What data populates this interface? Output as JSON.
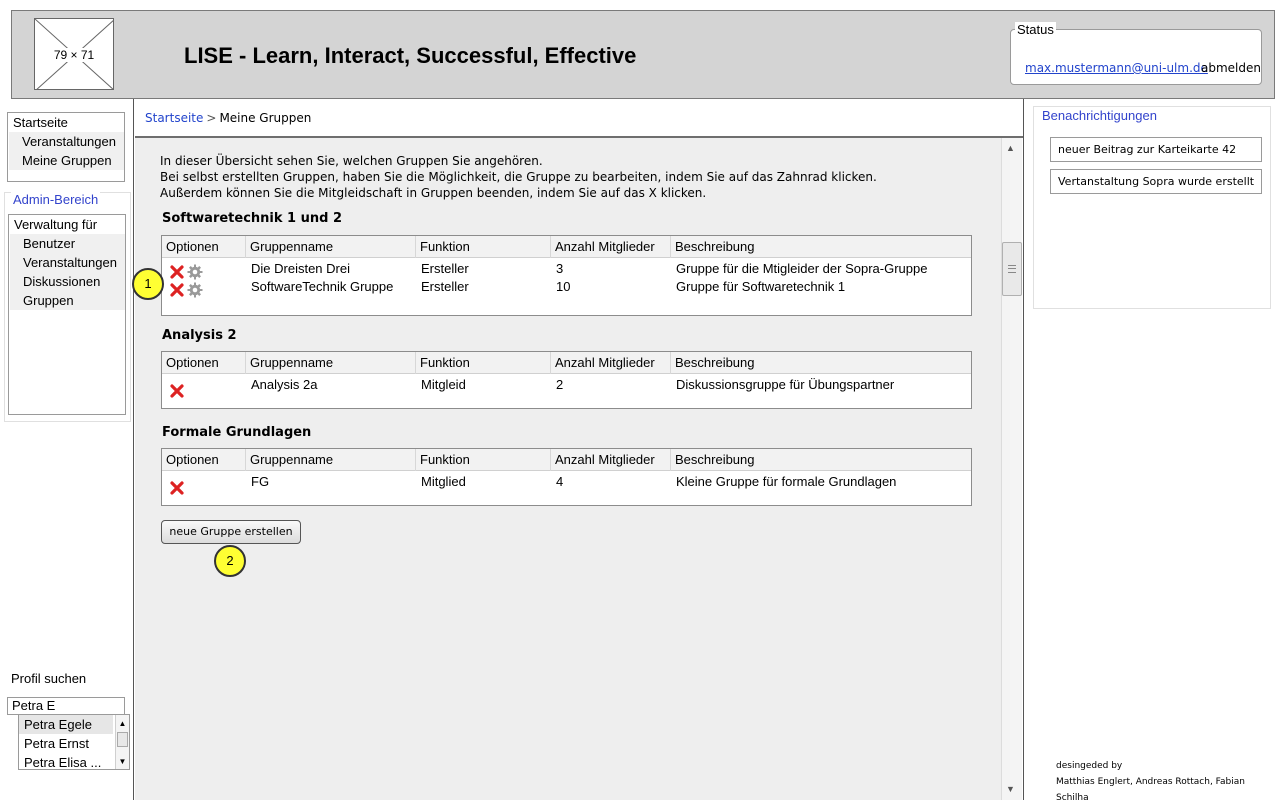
{
  "header": {
    "logo_placeholder": "79 × 71",
    "title": "LISE - Learn, Interact, Successful, Effective",
    "status": {
      "legend": "Status",
      "email": "max.mustermann@uni-ulm.de",
      "logout": "abmelden"
    }
  },
  "nav": {
    "title": "Startseite",
    "items": [
      "Veranstaltungen",
      "Meine Gruppen"
    ]
  },
  "admin": {
    "legend": "Admin-Bereich",
    "title": "Verwaltung für",
    "items": [
      "Benutzer",
      "Veranstaltungen",
      "Diskussionen",
      "Gruppen"
    ]
  },
  "profile_search": {
    "label": "Profil suchen",
    "value": "Petra E",
    "suggestions": [
      "Petra Egele",
      "Petra Ernst",
      "Petra Elisa ..."
    ]
  },
  "breadcrumb": {
    "home": "Startseite",
    "separator": ">",
    "current": "Meine Gruppen"
  },
  "intro": [
    "In dieser Übersicht sehen Sie, welchen Gruppen Sie angehören.",
    "Bei selbst erstellten Gruppen, haben Sie die Möglichkeit, die Gruppe zu bearbeiten, indem Sie auf das Zahnrad klicken.",
    "Außerdem können Sie die Mitgleidschaft in Gruppen beenden, indem Sie auf das X klicken."
  ],
  "table_headers": [
    "Optionen",
    "Gruppenname",
    "Funktion",
    "Anzahl Mitglieder",
    "Beschreibung"
  ],
  "sections": [
    {
      "title": "Softwaretechnik 1 und 2",
      "rows": [
        {
          "name": "Die Dreisten Drei",
          "function": "Ersteller",
          "members": "3",
          "description": "Gruppe für die Mtigleider der Sopra-Gruppe",
          "editable": true
        },
        {
          "name": "SoftwareTechnik Gruppe",
          "function": "Ersteller",
          "members": "10",
          "description": "Gruppe für Softwaretechnik 1",
          "editable": true
        }
      ]
    },
    {
      "title": "Analysis 2",
      "rows": [
        {
          "name": "Analysis 2a",
          "function": "Mitgleid",
          "members": "2",
          "description": "Diskussionsgruppe für Übungspartner",
          "editable": false
        }
      ]
    },
    {
      "title": "Formale Grundlagen",
      "rows": [
        {
          "name": "FG",
          "function": "Mitglied",
          "members": "4",
          "description": "Kleine Gruppe für formale Grundlagen",
          "editable": false
        }
      ]
    }
  ],
  "new_group_button": "neue Gruppe erstellen",
  "markers": [
    "1",
    "2"
  ],
  "notifications": {
    "legend": "Benachrichtigungen",
    "items": [
      "neuer Beitrag zur Karteikarte 42",
      "Vertanstaltung Sopra wurde erstellt"
    ]
  },
  "credits": {
    "line1": "desingeded by",
    "line2": "Matthias Englert, Andreas Rottach, Fabian Schilha"
  },
  "colors": {
    "link": "#2244cc",
    "marker": "#ffff33",
    "delete_icon": "#dd2222",
    "header_bg": "#d4d4d4",
    "content_bg": "#eeeeee"
  }
}
